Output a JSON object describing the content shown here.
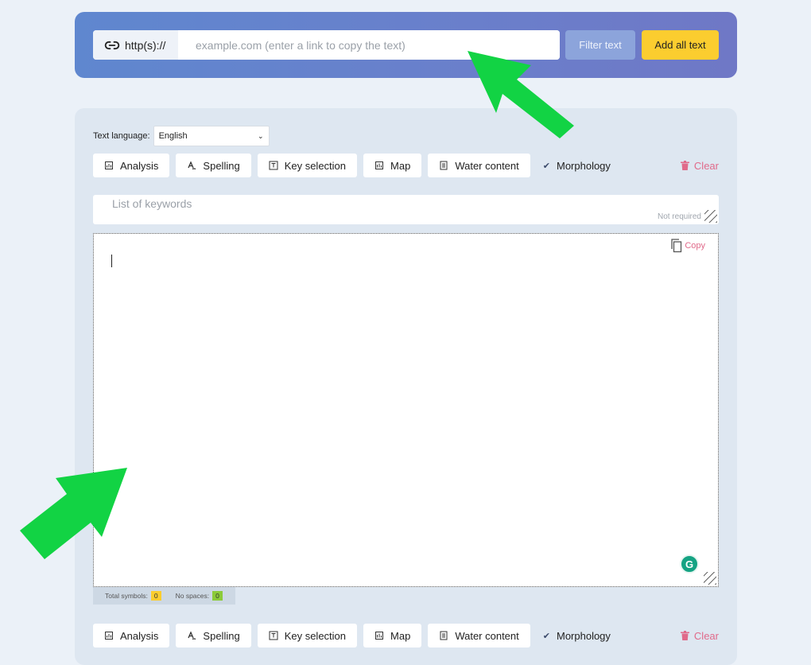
{
  "url_bar": {
    "prefix": "http(s)://",
    "placeholder": "example.com (enter a link to copy the text)",
    "filter_label": "Filter text",
    "add_all_label": "Add all text"
  },
  "language": {
    "label": "Text language:",
    "selected": "English"
  },
  "toolbar": {
    "analysis": "Analysis",
    "spelling": "Spelling",
    "key_selection": "Key selection",
    "map": "Map",
    "water_content": "Water content",
    "morphology": "Morphology",
    "morphology_checked": true,
    "clear": "Clear"
  },
  "keywords": {
    "placeholder": "List of keywords",
    "note": "Not required"
  },
  "editor": {
    "copy_label": "Copy",
    "grammarly_glyph": "G"
  },
  "stats": {
    "total_label": "Total symbols:",
    "total_value": "0",
    "nospaces_label": "No spaces:",
    "nospaces_value": "0"
  },
  "colors": {
    "accent_yellow": "#fbcd2f",
    "link_pink": "#e06a8a",
    "arrow_green": "#12d344",
    "panel_blue": "#6a7fcb"
  },
  "icons": [
    "link-icon",
    "analysis-icon",
    "spelling-icon",
    "key-selection-icon",
    "map-icon",
    "water-content-icon",
    "trash-icon",
    "copy-icon",
    "grammarly-icon",
    "arrow-pointer"
  ]
}
